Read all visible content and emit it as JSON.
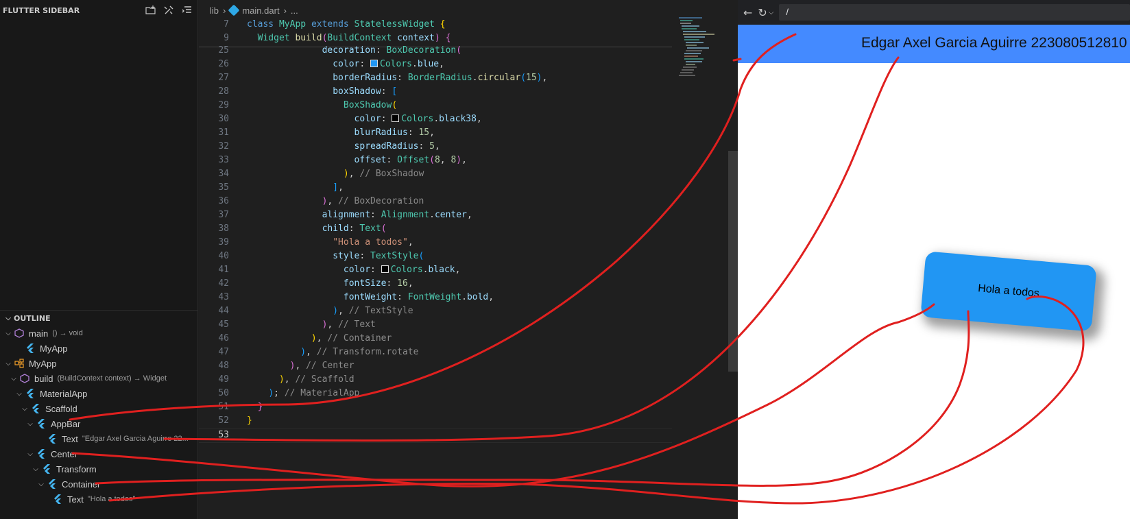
{
  "sidebar": {
    "title": "FLUTTER SIDEBAR",
    "icons": [
      "new-folder-icon",
      "tools-icon",
      "collapse-all-icon"
    ],
    "outline_title": "OUTLINE",
    "outline": [
      {
        "label": "main",
        "detail": "() → void",
        "icon": "function-icon",
        "expanded": true
      },
      {
        "label": "MyApp",
        "detail": "",
        "icon": "flutter-icon"
      },
      {
        "label": "MyApp",
        "detail": "",
        "icon": "class-icon",
        "expanded": true
      },
      {
        "label": "build",
        "detail": "(BuildContext context) → Widget",
        "icon": "method-icon",
        "expanded": true
      },
      {
        "label": "MaterialApp",
        "detail": "",
        "icon": "flutter-icon",
        "expanded": true
      },
      {
        "label": "Scaffold",
        "detail": "",
        "icon": "flutter-icon",
        "expanded": true
      },
      {
        "label": "AppBar",
        "detail": "",
        "icon": "flutter-icon",
        "expanded": true
      },
      {
        "label": "Text",
        "detail": "\"Edgar Axel Garcia Aguirre 22...",
        "icon": "flutter-icon"
      },
      {
        "label": "Center",
        "detail": "",
        "icon": "flutter-icon",
        "expanded": true
      },
      {
        "label": "Transform",
        "detail": "",
        "icon": "flutter-icon",
        "expanded": true
      },
      {
        "label": "Container",
        "detail": "",
        "icon": "flutter-icon",
        "expanded": true
      },
      {
        "label": "Text",
        "detail": "\"Hola a todos\"",
        "icon": "flutter-icon"
      }
    ]
  },
  "editor": {
    "breadcrumb": [
      "lib",
      "main.dart",
      "..."
    ],
    "sticky_lines": [
      7,
      9
    ],
    "visible_lines": [
      25,
      26,
      27,
      28,
      29,
      30,
      31,
      32,
      33,
      34,
      35,
      36,
      37,
      38,
      39,
      40,
      41,
      42,
      43,
      44,
      45,
      46,
      47,
      48,
      49,
      50,
      51,
      52,
      53
    ]
  },
  "browser": {
    "address": "/",
    "appbar_title": "Edgar Axel Garcia Aguirre 223080512810",
    "card_text": "Hola a todos",
    "card_rotation_deg": 5
  },
  "colors": {
    "appbar": "#448aff",
    "card": "#2196f3",
    "annotation": "#e0201f"
  }
}
